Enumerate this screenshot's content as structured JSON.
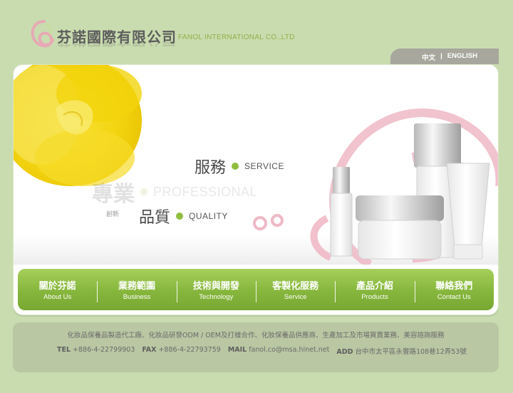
{
  "header": {
    "company_zh": "芬諾國際有限公司",
    "company_en": "FANOL INTERNATIONAL CO.,LTD",
    "lang": {
      "zh": "中文",
      "separator": "|",
      "en": "ENGLISH"
    }
  },
  "banner": {
    "service": {
      "zh": "服務",
      "en": "SERVICE"
    },
    "professional": {
      "zh": "專業",
      "en": "PROFESSIONAL"
    },
    "quality": {
      "zh": "品質",
      "en": "QUALITY"
    },
    "innovation": "創新"
  },
  "nav": [
    {
      "zh": "關於芬諾",
      "en": "About Us"
    },
    {
      "zh": "業務範圍",
      "en": "Business"
    },
    {
      "zh": "技術與開發",
      "en": "Technology"
    },
    {
      "zh": "客製化服務",
      "en": "Service"
    },
    {
      "zh": "產品介紹",
      "en": "Products"
    },
    {
      "zh": "聯絡我們",
      "en": "Contact Us"
    }
  ],
  "footer": {
    "services": "化妝品保養品製造代工廠、化妝品研發ODM / OEM及打樣合作、化妝保養品供應商、生產加工及市場買賣業務、美容諮詢服務",
    "tel_label": "TEL",
    "tel": "+886-4-22799903",
    "fax_label": "FAX",
    "fax": "+886-4-22793759",
    "mail_label": "MAIL",
    "mail": "fanol.co@msa.hinet.net",
    "add_label": "ADD",
    "add": "台中市太平區永豐路108巷12弄53號"
  },
  "colors": {
    "background": "#c9dcaf",
    "accent_green": "#8fbe3e",
    "nav_green": "#86b63c",
    "footer_bg": "#b9c7a3",
    "flower_yellow": "#f5d80a",
    "swirl_pink": "#efb9c6"
  }
}
